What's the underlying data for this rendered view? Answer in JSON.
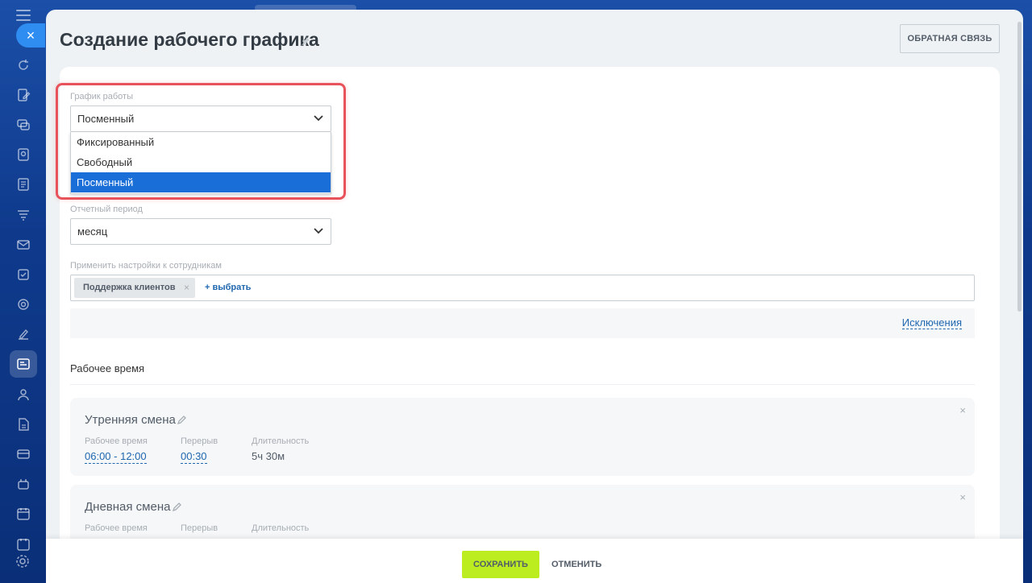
{
  "panel": {
    "title": "Создание рабочего графика",
    "feedback_label": "ОБРАТНАЯ СВЯЗЬ"
  },
  "schedule_type": {
    "label": "График работы",
    "value": "Посменный",
    "options": [
      "Фиксированный",
      "Свободный",
      "Посменный"
    ],
    "selected_index": 2
  },
  "report_period": {
    "label": "Отчетный период",
    "value": "месяц"
  },
  "employees": {
    "label": "Применить настройки к сотрудникам",
    "chip": "Поддержка клиентов",
    "chip_remove": "×",
    "add_link": "+ выбрать"
  },
  "exceptions_link": "Исключения",
  "working_time": {
    "title": "Рабочее время",
    "shifts": [
      {
        "name": "Утренняя смена",
        "close": "×",
        "work_time_label": "Рабочее время",
        "work_time": "06:00 - 12:00",
        "break_label": "Перерыв",
        "break": "00:30",
        "duration_label": "Длительность",
        "duration": "5ч 30м"
      },
      {
        "name": "Дневная смена",
        "close": "×",
        "work_time_label": "Рабочее время",
        "break_label": "Перерыв",
        "duration_label": "Длительность"
      }
    ]
  },
  "footer": {
    "save_label": "СОХРАНИТЬ",
    "cancel_label": "ОТМЕНИТЬ"
  },
  "sidebar": {
    "close_label": "×",
    "icons": [
      "refresh-icon",
      "document-edit-icon",
      "chat-icon",
      "contact-icon",
      "form-icon",
      "filter-icon",
      "mail-icon",
      "task-icon",
      "target-icon",
      "sign-icon",
      "timesheet-icon",
      "people-icon",
      "file-icon",
      "card-icon",
      "robot-icon",
      "calendar-icon",
      "calendar2-icon",
      "gear-icon"
    ],
    "active_index": 10
  },
  "colors": {
    "accent": "#1a6ed8",
    "highlight": "#e8525b",
    "save": "#bbed21",
    "link": "#2067b0"
  }
}
